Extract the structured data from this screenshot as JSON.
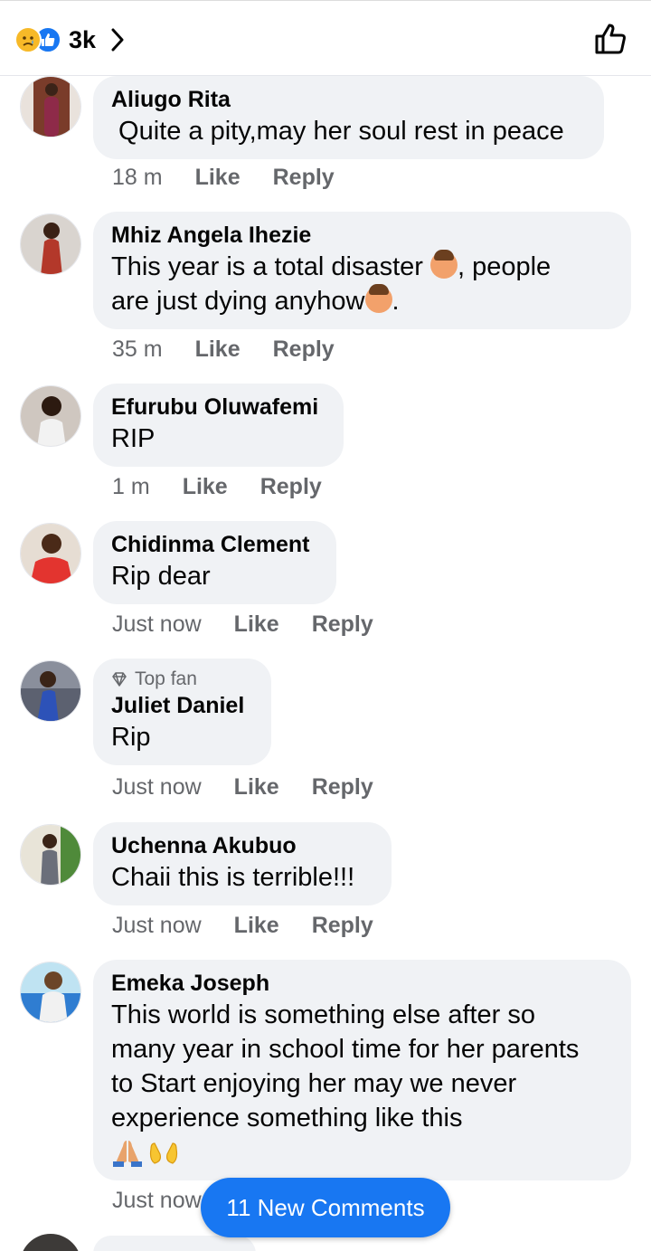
{
  "header": {
    "reaction_count": "3k",
    "icons": [
      "sad-reaction-icon",
      "like-reaction-icon",
      "chevron-right-icon",
      "thumbs-up-outline-icon"
    ]
  },
  "comments": [
    {
      "author": "Aliugo Rita",
      "text": " Quite a pity,may her soul rest in peace",
      "time": "18 m",
      "like": "Like",
      "reply": "Reply"
    },
    {
      "author": "Mhiz Angela Ihezie",
      "text_a": "This year is a total disaster ",
      "text_b": ", people",
      "text_c": "are just dying anyhow",
      "text_d": ".",
      "time": "35 m",
      "like": "Like",
      "reply": "Reply"
    },
    {
      "author": "Efurubu Oluwafemi",
      "text": "RIP",
      "time": "1 m",
      "like": "Like",
      "reply": "Reply"
    },
    {
      "author": "Chidinma Clement",
      "text": "Rip dear",
      "time": "Just now",
      "like": "Like",
      "reply": "Reply"
    },
    {
      "badge": "Top fan",
      "author": "Juliet Daniel",
      "text": "Rip",
      "time": "Just now",
      "like": "Like",
      "reply": "Reply"
    },
    {
      "author": "Uchenna Akubuo",
      "text": "Chaii this is terrible!!!",
      "time": "Just now",
      "like": "Like",
      "reply": "Reply"
    },
    {
      "author": "Emeka Joseph",
      "lines": [
        "This world is something else after so",
        "many year in school time for her parents",
        "to Start enjoying her may we never",
        "experience something like this"
      ],
      "time": "Just now"
    }
  ],
  "new_comments_button": "11 New Comments",
  "colors": {
    "accent": "#1877f2",
    "bubble": "#f0f2f5",
    "meta": "#65676b"
  }
}
